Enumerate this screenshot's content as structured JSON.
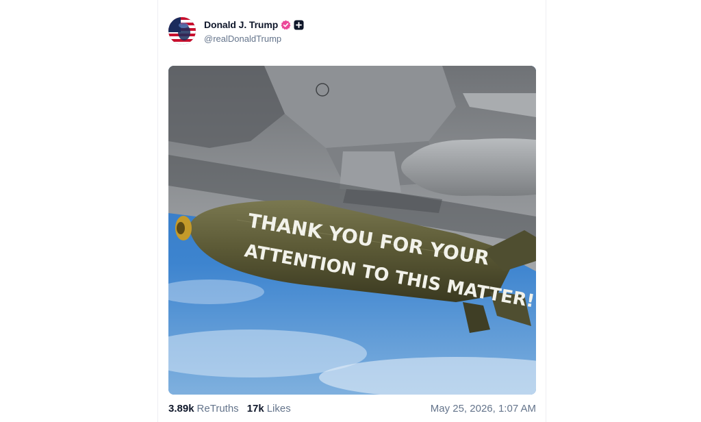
{
  "post": {
    "author": {
      "display_name": "Donald J. Trump",
      "handle": "@realDonaldTrump",
      "verified_icon": "verified-check-icon",
      "plus_icon": "plus-badge-icon"
    },
    "image": {
      "bomb_text_line1": "THANK YOU FOR YOUR",
      "bomb_text_line2": "ATTENTION TO THIS MATTER!"
    },
    "stats": {
      "retruths_count": "3.89k",
      "retruths_label": "ReTruths",
      "likes_count": "17k",
      "likes_label": "Likes"
    },
    "timestamp": "May 25, 2026, 1:07 AM"
  },
  "colors": {
    "verified": "#ec4899",
    "sky": "#3a7cc6",
    "bomb": "#5b5a36",
    "aircraft": "#8a8d90"
  }
}
